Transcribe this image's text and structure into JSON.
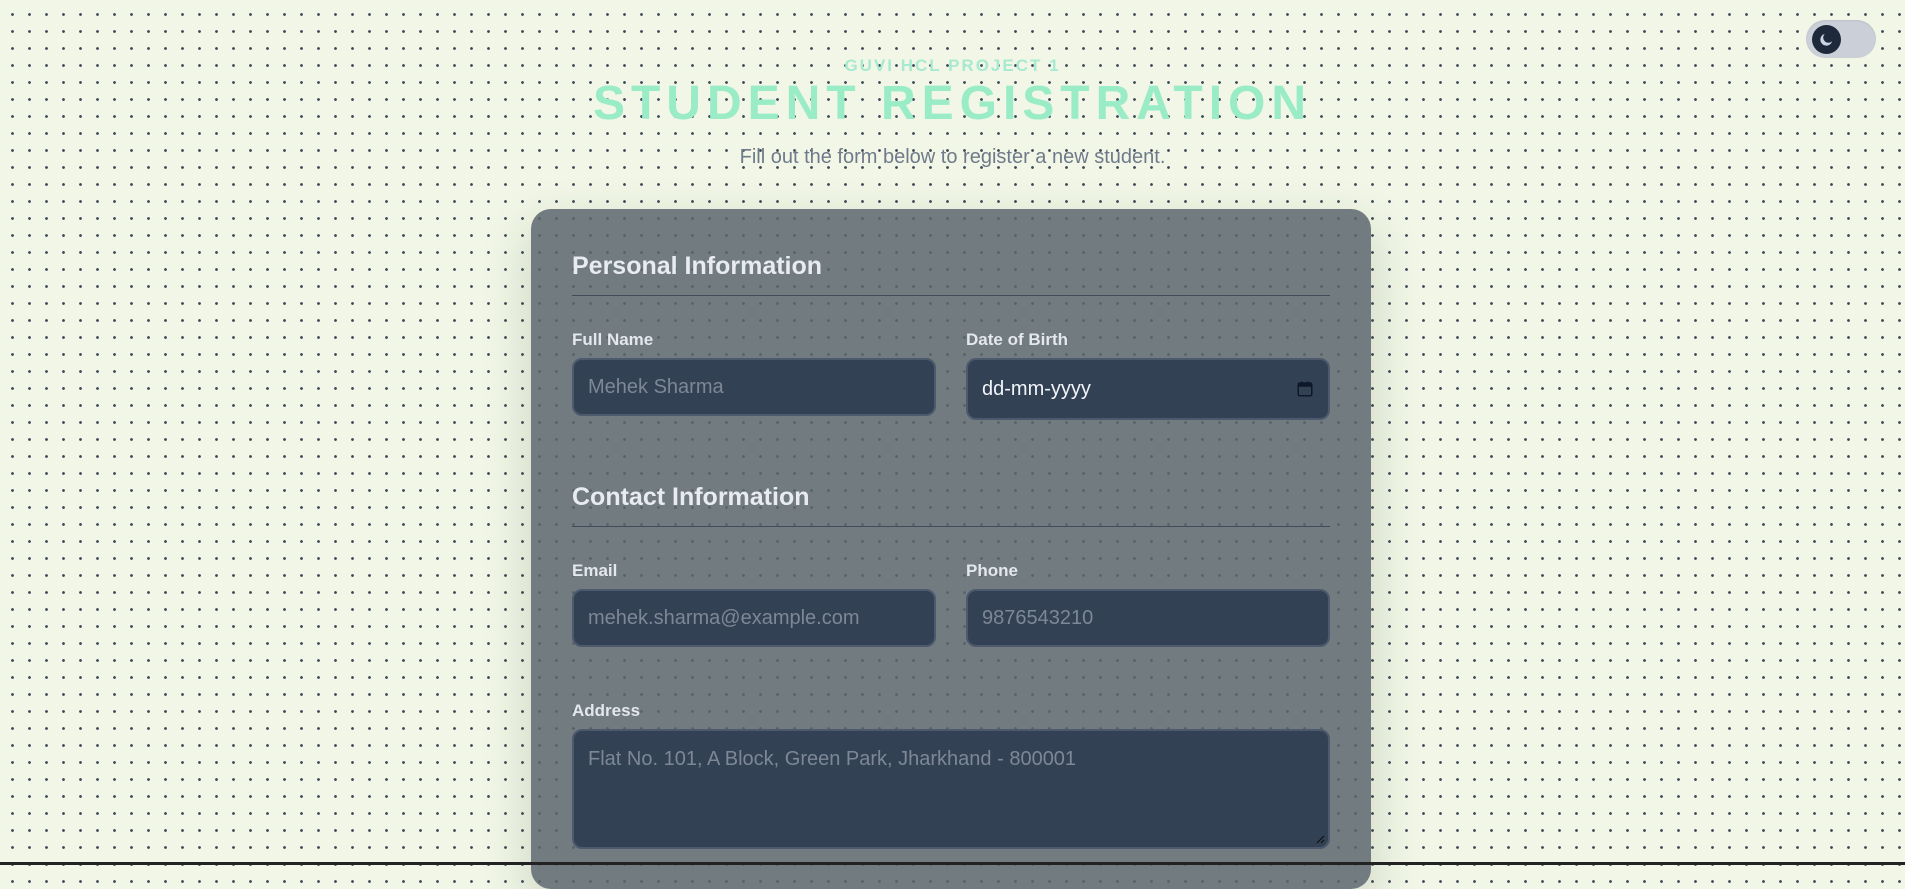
{
  "header": {
    "eyebrow": "GUVI HCL PROJECT 1",
    "title": "STUDENT REGISTRATION",
    "subtitle": "Fill out the form below to register a new student."
  },
  "theme_toggle": {
    "icon": "moon-icon",
    "state": "dark-mode"
  },
  "sections": {
    "personal": {
      "title": "Personal Information",
      "full_name": {
        "label": "Full Name",
        "placeholder": "Mehek Sharma"
      },
      "dob": {
        "label": "Date of Birth",
        "value": "dd-mm-yyyy",
        "icon": "calendar-icon"
      }
    },
    "contact": {
      "title": "Contact Information",
      "email": {
        "label": "Email",
        "placeholder": "mehek.sharma@example.com"
      },
      "phone": {
        "label": "Phone",
        "placeholder": "9876543210"
      },
      "address": {
        "label": "Address",
        "placeholder": "Flat No. 101, A Block, Green Park, Jharkhand - 800001"
      }
    }
  },
  "colors": {
    "page_background": "#f1f6e6",
    "accent_heading": "#99ecc6",
    "card_background": "#5c656c",
    "input_background": "#334155",
    "toggle_track": "#cbd0d8",
    "toggle_knob": "#1e293b"
  }
}
